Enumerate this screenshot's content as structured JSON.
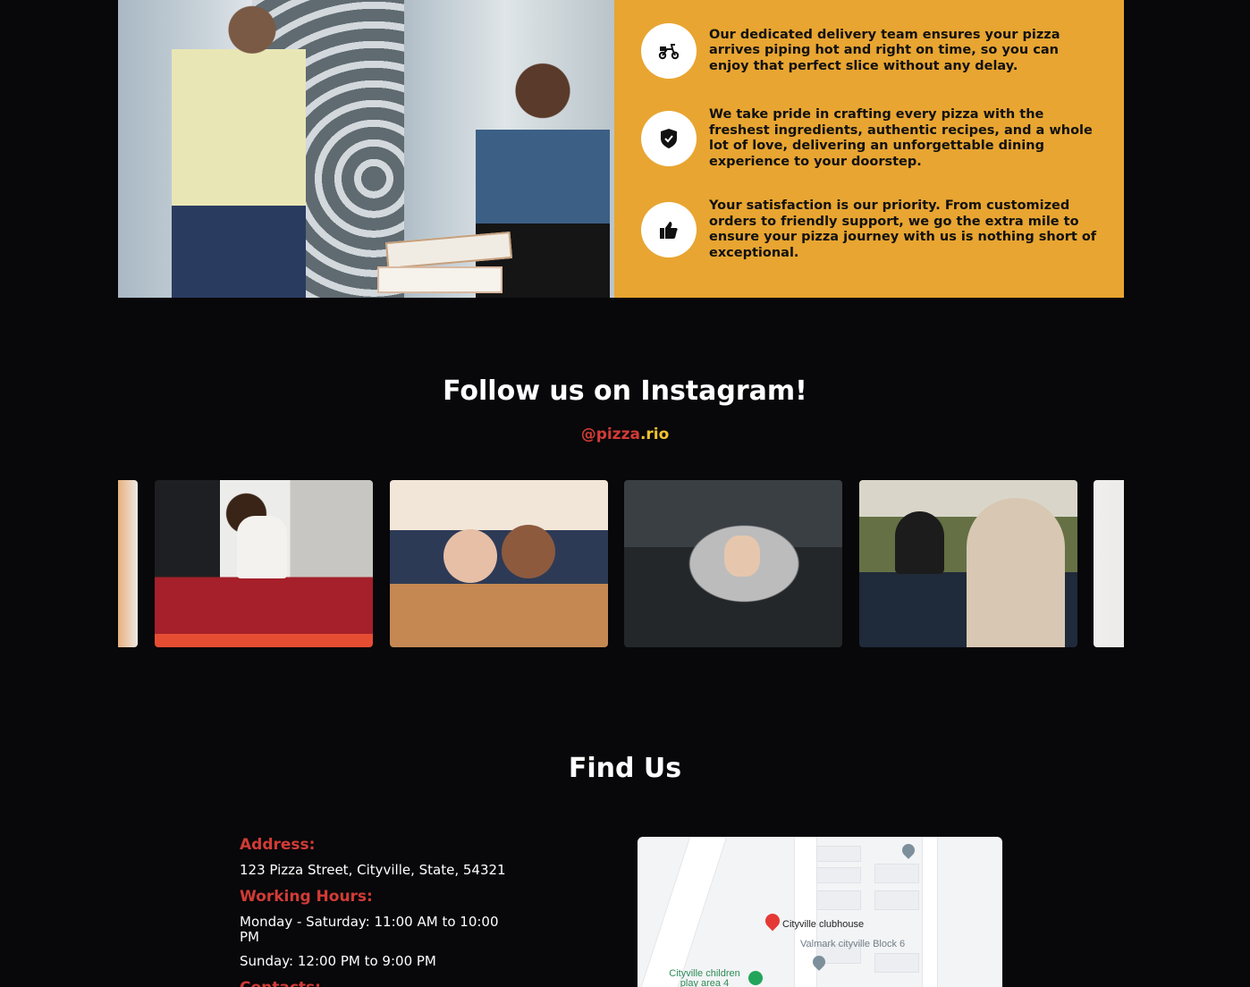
{
  "features": [
    {
      "icon": "scooter-icon",
      "text": "Our dedicated delivery team ensures your pizza arrives piping hot and right on time, so you can enjoy that perfect slice without any delay."
    },
    {
      "icon": "shield-check-icon",
      "text": "We take pride in crafting every pizza with the freshest ingredients, authentic recipes, and a whole lot of love, delivering an unforgettable dining experience to your doorstep."
    },
    {
      "icon": "thumbs-up-icon",
      "text": "Your satisfaction is our priority. From customized orders to friendly support, we go the extra mile to ensure your pizza journey with us is nothing short of exceptional."
    }
  ],
  "instagram": {
    "title": "Follow us on Instagram!",
    "handle_part1": "@pizza",
    "handle_part2": ".rio"
  },
  "find_us": {
    "title": "Find Us",
    "address_label": "Address:",
    "address": "123 Pizza Street, Cityville, State, 54321",
    "hours_label": "Working Hours:",
    "hours_weekdays": "Monday - Saturday: 11:00 AM to 10:00 PM",
    "hours_sunday": "Sunday: 12:00 PM to 9:00 PM",
    "contacts_label": "Contacts:"
  },
  "map": {
    "place_main": "Cityville clubhouse",
    "place_secondary": "Valmark cityville Block 6",
    "place_park": "Cityville children play area 4"
  },
  "colors": {
    "accent_red": "#d23b36",
    "accent_yellow": "#f2c230",
    "panel_orange": "#e8a531",
    "background": "#080709"
  }
}
